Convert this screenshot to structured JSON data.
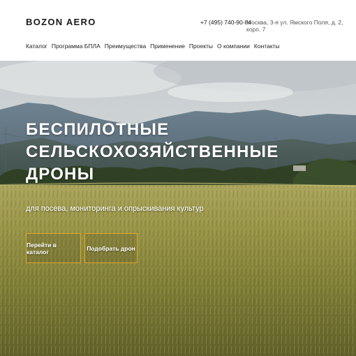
{
  "header": {
    "logo": "BOZON AERO",
    "phone": "+7 (495) 740-90-84",
    "address": "Москва, 3-я ул. Ямского Поля, д. 2, корп. 7"
  },
  "nav": {
    "items": [
      {
        "label": "Каталог"
      },
      {
        "label": "Программа БПЛА"
      },
      {
        "label": "Преимущества"
      },
      {
        "label": "Применение"
      },
      {
        "label": "Проекты"
      },
      {
        "label": "О компании"
      },
      {
        "label": "Контакты"
      }
    ]
  },
  "hero": {
    "title_lines": [
      "БЕСПИЛОТНЫЕ",
      "СЕЛЬСКОХОЗЯЙСТВЕННЫЕ",
      "ДРОНЫ"
    ],
    "subtitle": "для посева, мониторинга и опрыскивания культур",
    "buttons": {
      "catalog": "Перейти в каталог",
      "pick": "Подобрать дрон"
    }
  },
  "colors": {
    "accent": "#e0a52a",
    "sky": "#cfd6da",
    "field": "#9a9a3e"
  }
}
